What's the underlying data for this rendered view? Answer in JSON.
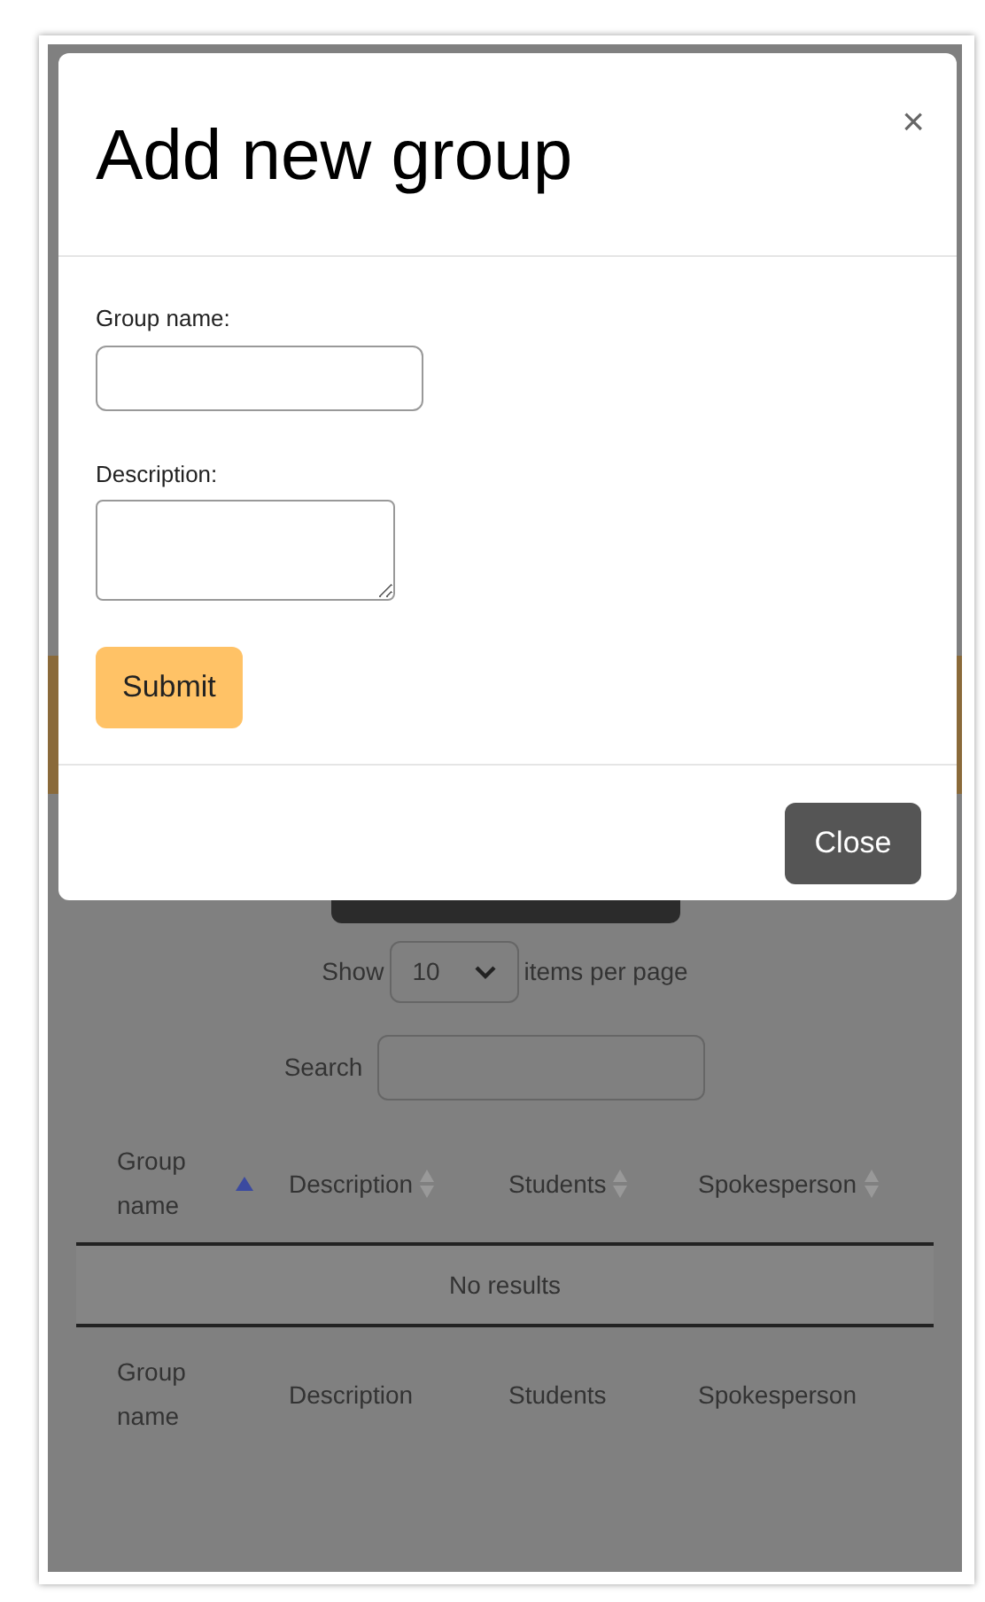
{
  "modal": {
    "title": "Add new group",
    "close_icon": "×",
    "fields": [
      {
        "label": "Group name:",
        "kind": "input"
      },
      {
        "label": "Description:",
        "kind": "textarea"
      }
    ],
    "submit": "Submit",
    "close": "Close"
  },
  "page": {
    "show_label": "Show",
    "per_page": "10",
    "per_page_suffix": "items per page",
    "search_label": "Search",
    "columns": [
      {
        "label": "Group name",
        "selected": true
      },
      {
        "label": "Description",
        "selected": false
      },
      {
        "label": "Students",
        "selected": false
      },
      {
        "label": "Spokesperson",
        "selected": false
      }
    ],
    "empty": "No results",
    "footer": [
      "Group name",
      "Description",
      "Students",
      "Spokesperson"
    ]
  }
}
